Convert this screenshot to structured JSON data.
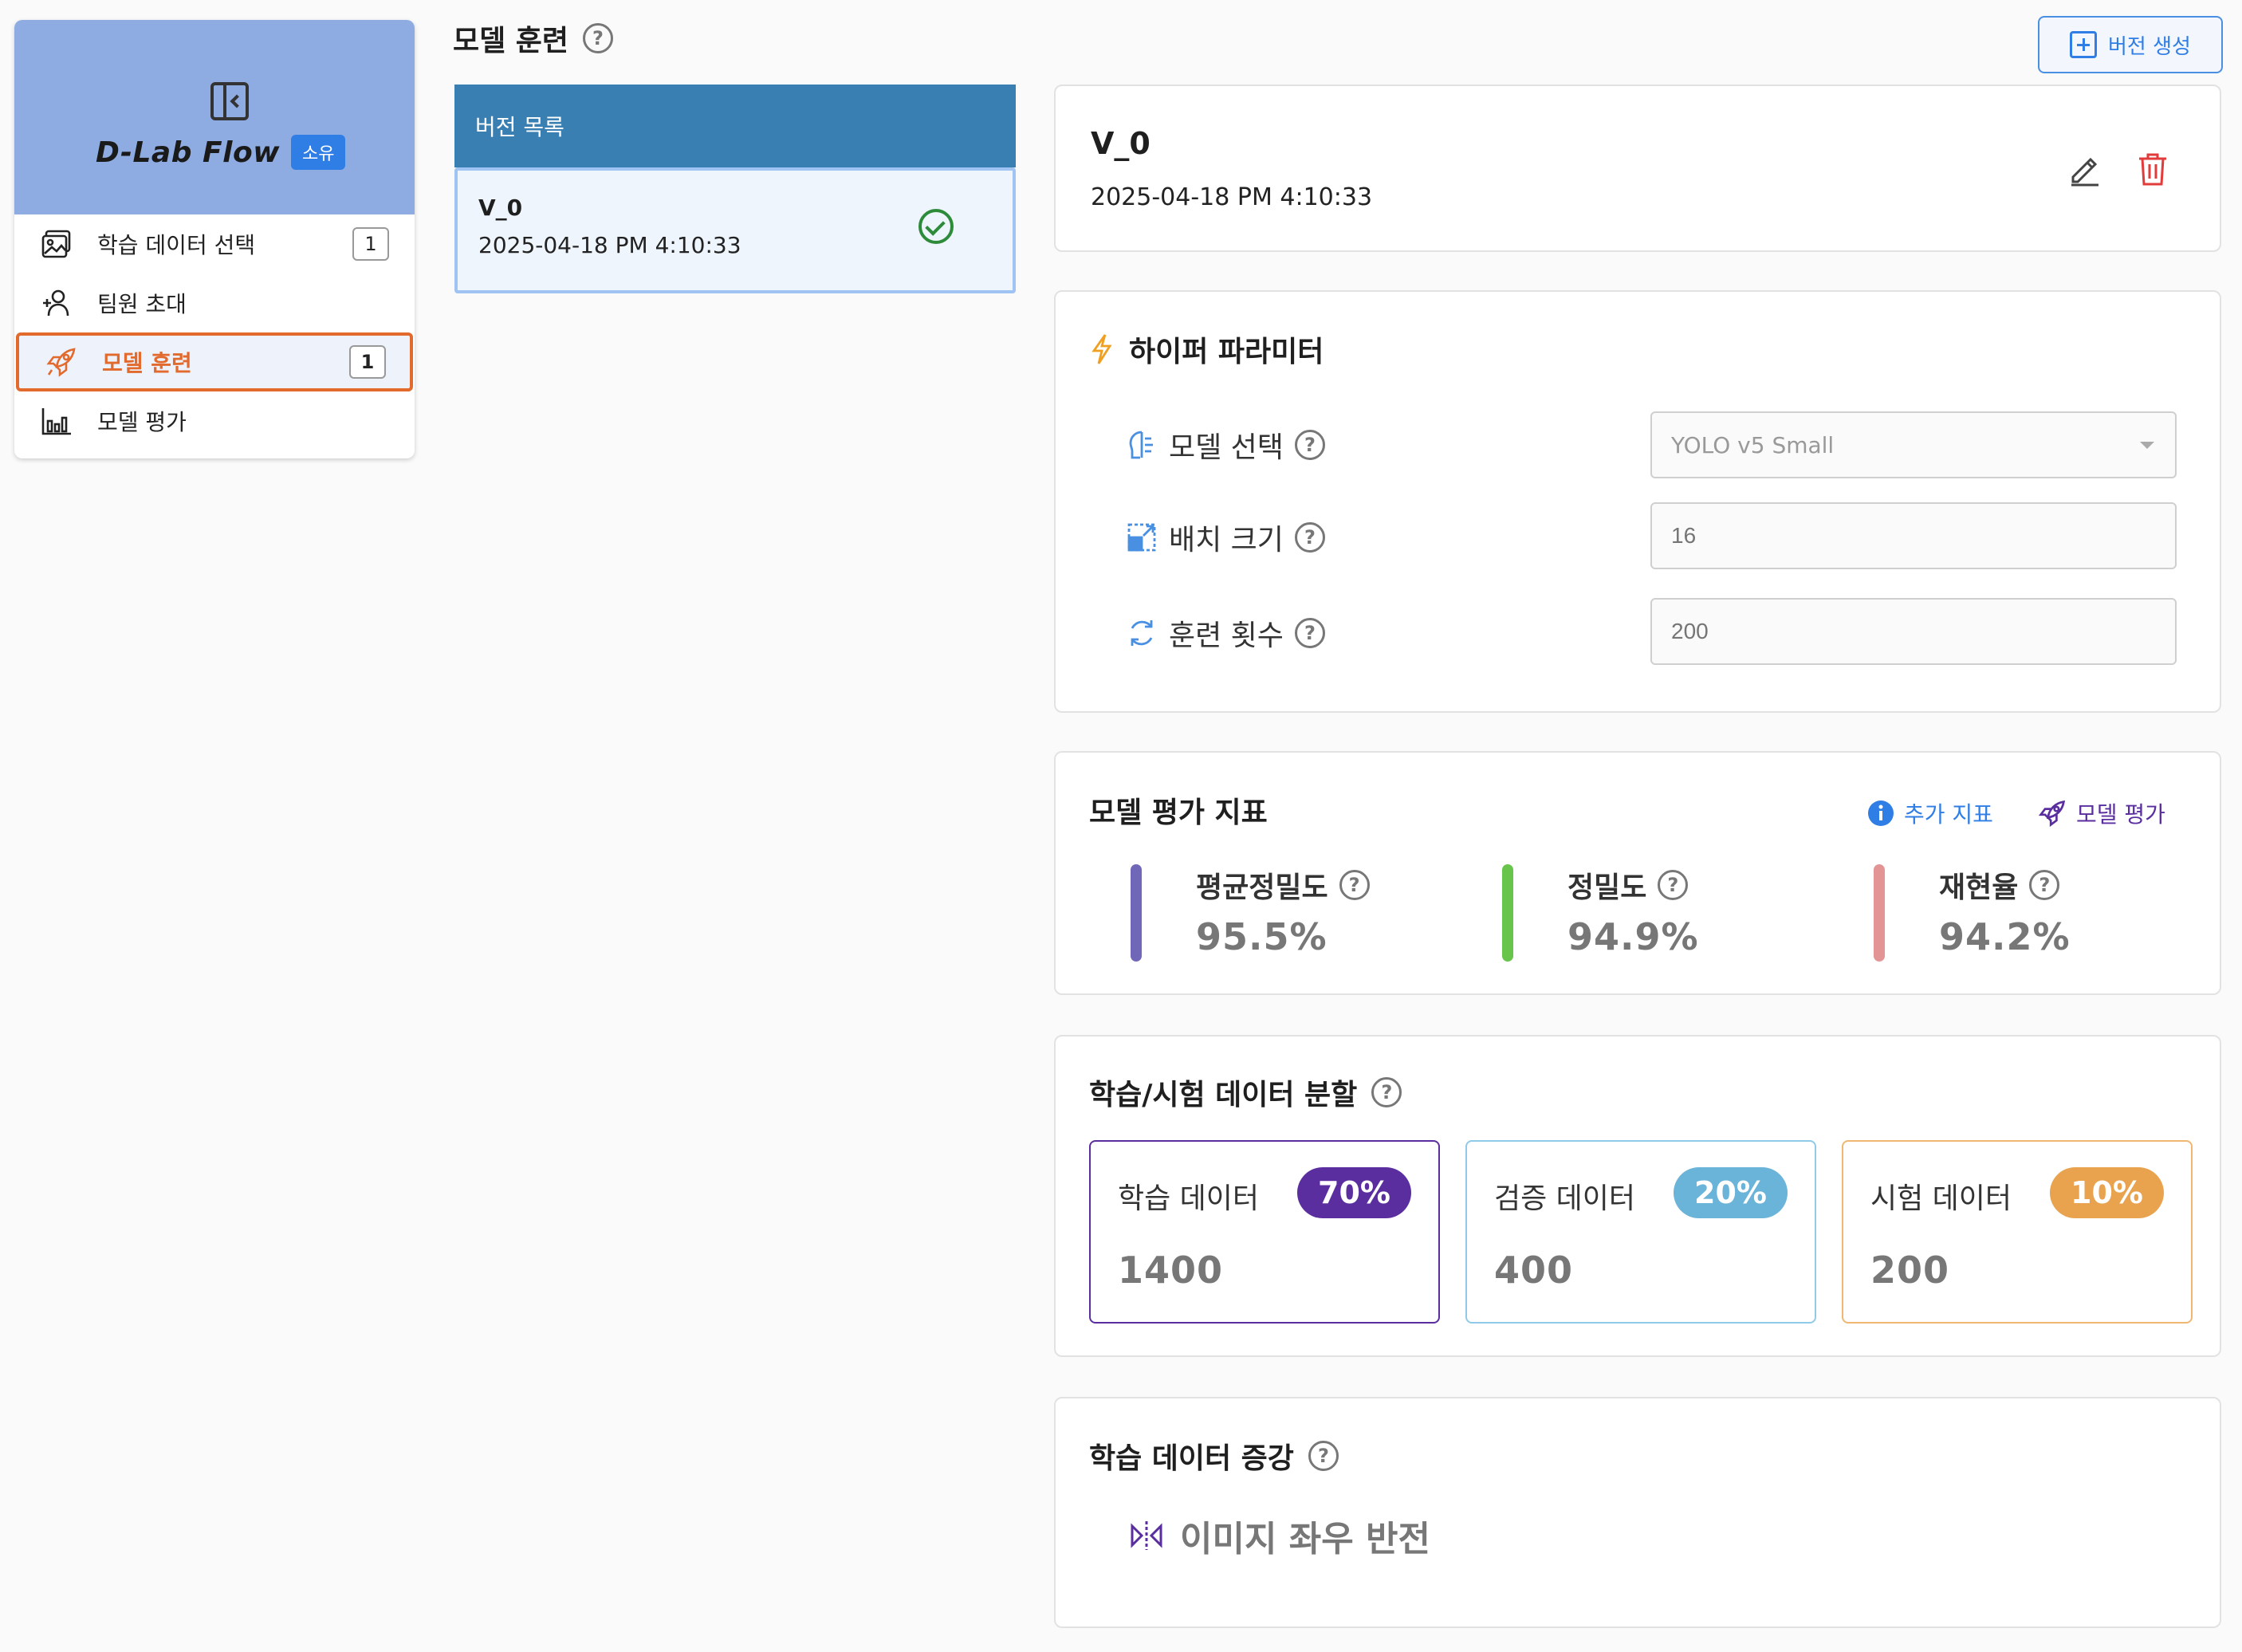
{
  "sidebar": {
    "brand_title": "D-Lab Flow",
    "brand_badge": "소유",
    "items": [
      {
        "label": "학습 데이터 선택",
        "count": "1"
      },
      {
        "label": "팀원 초대",
        "count": ""
      },
      {
        "label": "모델 훈련",
        "count": "1"
      },
      {
        "label": "모델 평가",
        "count": ""
      }
    ]
  },
  "page": {
    "title": "모델 훈련",
    "help": "?",
    "new_version_label": "버전 생성"
  },
  "version_list": {
    "header": "버전 목록",
    "items": [
      {
        "name": "V_0",
        "date": "2025-04-18 PM 4:10:33"
      }
    ]
  },
  "version_detail": {
    "name": "V_0",
    "date": "2025-04-18 PM 4:10:33"
  },
  "hyperparams": {
    "title": "하이퍼 파라미터",
    "model": {
      "label": "모델 선택",
      "value": "YOLO v5 Small"
    },
    "batch": {
      "label": "배치 크기",
      "placeholder": "16"
    },
    "epochs": {
      "label": "훈련 횟수",
      "placeholder": "200"
    }
  },
  "metrics": {
    "title": "모델 평가 지표",
    "extra_link": "추가 지표",
    "eval_link": "모델 평가",
    "items": [
      {
        "name": "평균정밀도",
        "value": "95.5%",
        "color": "#7167b8"
      },
      {
        "name": "정밀도",
        "value": "94.9%",
        "color": "#66c54a"
      },
      {
        "name": "재현율",
        "value": "94.2%",
        "color": "#e39595"
      }
    ]
  },
  "split": {
    "title": "학습/시험 데이터 분할",
    "items": [
      {
        "name": "학습 데이터",
        "pct": "70%",
        "count": "1400",
        "color": "#5b2ea0"
      },
      {
        "name": "검증 데이터",
        "pct": "20%",
        "count": "400",
        "color": "#6ab3d9"
      },
      {
        "name": "시험 데이터",
        "pct": "10%",
        "count": "200",
        "color": "#e9a24d"
      }
    ]
  },
  "augmentation": {
    "title": "학습 데이터 증강",
    "items": [
      {
        "label": "이미지 좌우 반전"
      }
    ]
  },
  "colors": {
    "accent_blue": "#2f7ee6",
    "active_orange": "#e16a2c",
    "sidebar_header": "#8eabe2",
    "list_header": "#3a7fb2"
  }
}
